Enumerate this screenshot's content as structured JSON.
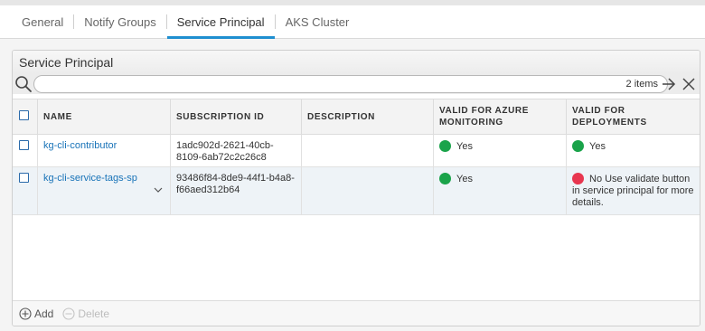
{
  "tabs": [
    {
      "label": "General"
    },
    {
      "label": "Notify Groups"
    },
    {
      "label": "Service Principal"
    },
    {
      "label": "AKS Cluster"
    }
  ],
  "active_tab": "Service Principal",
  "panel": {
    "title": "Service Principal",
    "search": {
      "count_text": "2 items",
      "value": ""
    },
    "columns": [
      "NAME",
      "SUBSCRIPTION ID",
      "DESCRIPTION",
      "VALID FOR AZURE MONITORING",
      "VALID FOR DEPLOYMENTS"
    ],
    "rows": [
      {
        "name": "kg-cli-contributor",
        "subscription_id": "1adc902d-2621-40cb-8109-6ab72c2c26c8",
        "description": "",
        "azure_monitoring": "Yes",
        "azure_monitoring_status": "green",
        "deployments": "Yes",
        "deployments_status": "green"
      },
      {
        "name": "kg-cli-service-tags-sp",
        "subscription_id": "93486f84-8de9-44f1-b4a8-f66aed312b64",
        "description": "",
        "azure_monitoring": "Yes",
        "azure_monitoring_status": "green",
        "deployments": "No  Use validate button in service principal for more details.",
        "deployments_status": "red"
      }
    ],
    "footer": {
      "add_label": "Add",
      "delete_label": "Delete"
    }
  },
  "colors": {
    "accent": "#1f8fd0",
    "link": "#1873b8",
    "green": "#1aa34a",
    "red": "#e8364f"
  }
}
